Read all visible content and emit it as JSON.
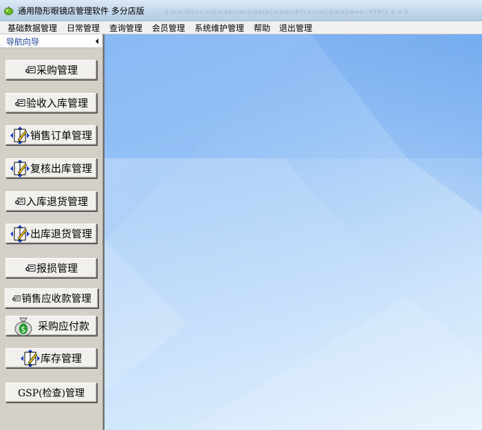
{
  "window": {
    "title": "通用隐形眼镜店管理软件   多分店版",
    "path_hint": "...\\Local\\Shuxin\\DataAccess\\DataCenter\\AllLenses\\DataOwner\\VER\\1.0.0.5"
  },
  "menu": [
    "基础数据管理",
    "日常管理",
    "查询管理",
    "会员管理",
    "系统维护管理",
    "帮助",
    "退出管理"
  ],
  "nav": {
    "title": "导航向导",
    "buttons": [
      {
        "label": "采购管理",
        "icon": "module-icon"
      },
      {
        "label": "验收入库管理",
        "icon": "module-icon"
      },
      {
        "label": "销售订单管理",
        "icon": "book-edit-icon"
      },
      {
        "label": "复核出库管理",
        "icon": "book-edit-icon"
      },
      {
        "label": "入库退货管理",
        "icon": "module-icon"
      },
      {
        "label": "出库退货管理",
        "icon": "book-edit-icon"
      },
      {
        "label": "报损管理",
        "icon": "module-icon"
      },
      {
        "label": "销售应收款管理",
        "icon": "module-icon"
      },
      {
        "label": "采购应付款",
        "icon": "money-bag-icon"
      },
      {
        "label": "库存管理",
        "icon": "book-edit-icon"
      },
      {
        "label": "GSP(检查)管理",
        "icon": ""
      }
    ]
  }
}
